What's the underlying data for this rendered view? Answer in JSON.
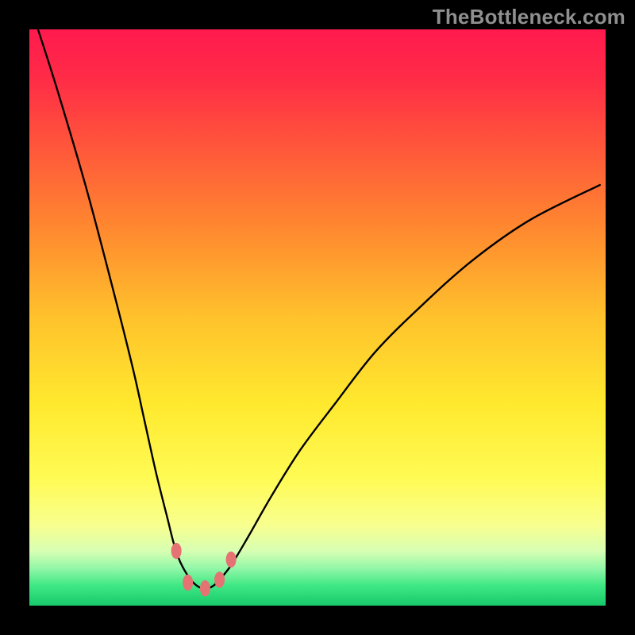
{
  "watermark": "TheBottleneck.com",
  "chart_data": {
    "type": "line",
    "title": "",
    "xlabel": "",
    "ylabel": "",
    "xlim": [
      0,
      100
    ],
    "ylim": [
      0,
      100
    ],
    "series": [
      {
        "name": "gradient-background",
        "description": "Vertical gradient from red (top) through orange/yellow to green (bottom).",
        "stops": [
          {
            "offset": 0.0,
            "color": "#ff1a4e"
          },
          {
            "offset": 0.08,
            "color": "#ff2a47"
          },
          {
            "offset": 0.2,
            "color": "#ff553b"
          },
          {
            "offset": 0.35,
            "color": "#ff8a2f"
          },
          {
            "offset": 0.5,
            "color": "#ffc22c"
          },
          {
            "offset": 0.65,
            "color": "#ffe92e"
          },
          {
            "offset": 0.78,
            "color": "#fffb55"
          },
          {
            "offset": 0.86,
            "color": "#f8ff8e"
          },
          {
            "offset": 0.905,
            "color": "#d8ffb3"
          },
          {
            "offset": 0.935,
            "color": "#93f7a8"
          },
          {
            "offset": 0.965,
            "color": "#3fe884"
          },
          {
            "offset": 1.0,
            "color": "#18c96a"
          }
        ]
      },
      {
        "name": "bottleneck-curve",
        "description": "V-shaped curve; left branch rises steeply to near top, right branch rises more gently.",
        "x": [
          1.5,
          5,
          10,
          15,
          18,
          20,
          22,
          24,
          25,
          26,
          27,
          28,
          29,
          30,
          31,
          32,
          33,
          35,
          38,
          42,
          47,
          53,
          60,
          68,
          77,
          87,
          99
        ],
        "y": [
          100,
          89,
          72,
          53,
          41,
          32,
          23,
          15,
          11,
          8,
          6,
          4.5,
          3.5,
          3,
          3,
          3.5,
          4.5,
          7,
          12,
          19,
          27,
          35,
          44,
          52,
          60,
          67,
          73
        ]
      },
      {
        "name": "markers",
        "description": "Pink rounded markers near the trough of the curve.",
        "points": [
          {
            "x": 25.5,
            "y": 9.5
          },
          {
            "x": 27.5,
            "y": 4
          },
          {
            "x": 30.5,
            "y": 3
          },
          {
            "x": 33.0,
            "y": 4.5
          },
          {
            "x": 35.0,
            "y": 8
          }
        ],
        "marker_color": "#e57373",
        "marker_rx": 0.9,
        "marker_ry": 1.4
      }
    ]
  }
}
